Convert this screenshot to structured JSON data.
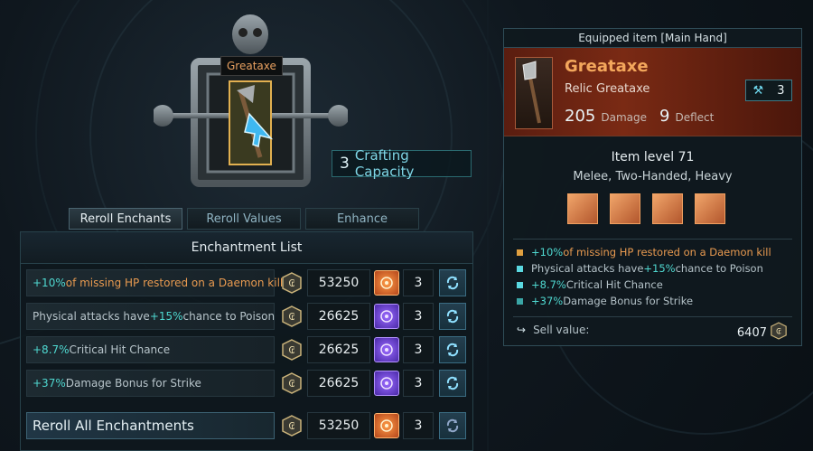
{
  "altar": {
    "item_tag": "Greataxe",
    "crafting_capacity_value": "3",
    "crafting_capacity_label": "Crafting Capacity"
  },
  "tabs": [
    {
      "label": "Reroll Enchants",
      "active": true
    },
    {
      "label": "Reroll Values",
      "active": false
    },
    {
      "label": "Enhance",
      "active": false
    }
  ],
  "enchant_list": {
    "title": "Enchantment List",
    "rows": [
      {
        "pre": "+10%",
        "text": " of missing HP restored on a Daemon kill",
        "text_color": "orange",
        "cost": "53250",
        "rune": "orange",
        "qty": "3"
      },
      {
        "pre": "",
        "text": "Physical attacks have ",
        "hl": "+15%",
        "post": " chance to Poison",
        "cost": "26625",
        "rune": "purple",
        "qty": "3"
      },
      {
        "pre": "+8.7%",
        "text": " Critical Hit Chance",
        "cost": "26625",
        "rune": "purple",
        "qty": "3"
      },
      {
        "pre": "+37%",
        "text": " Damage Bonus for Strike",
        "cost": "26625",
        "rune": "purple",
        "qty": "3"
      }
    ],
    "reroll_all": {
      "label": "Reroll All Enchantments",
      "cost": "53250",
      "rune": "orange",
      "qty": "3"
    }
  },
  "tooltip": {
    "header": "Equipped item [Main Hand]",
    "name": "Greataxe",
    "type": "Relic Greataxe",
    "crafting": "3",
    "damage_value": "205",
    "damage_label": "Damage",
    "deflect_value": "9",
    "deflect_label": "Deflect",
    "item_level": "Item level 71",
    "tags": "Melee, Two-Handed, Heavy",
    "enchants": [
      {
        "pre": "+10%",
        "text": " of missing HP restored on a Daemon kill",
        "bullet": "#e0a040"
      },
      {
        "pre": "",
        "text": "Physical attacks have ",
        "hl": "+15%",
        "post": " chance to Poison",
        "bullet": "#5ad8e0"
      },
      {
        "pre": "+8.7%",
        "text": " Critical Hit Chance",
        "bullet": "#5ad8e0"
      },
      {
        "pre": "+37%",
        "text": " Damage Bonus for Strike",
        "bullet": "#3aa6a6"
      }
    ],
    "sell_label": "Sell value:",
    "sell_value": "6407"
  },
  "colors": {
    "accent_cyan": "#4fd8d0",
    "accent_orange": "#e89a50",
    "relic_red": "#7a2a14"
  }
}
